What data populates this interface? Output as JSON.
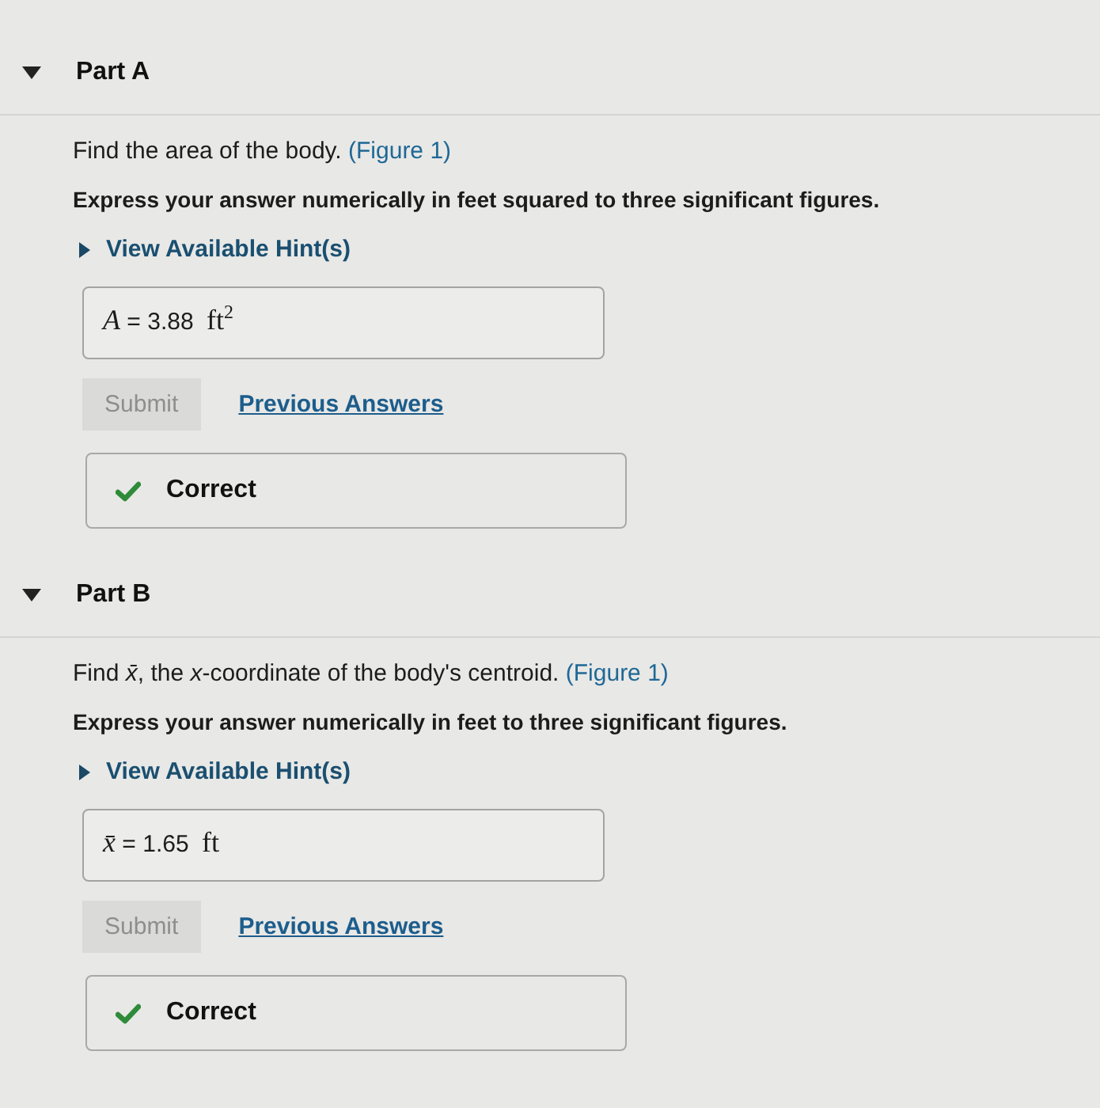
{
  "parts": [
    {
      "title": "Part A",
      "expanded": true,
      "prompt": "Find the area of the body.",
      "figure_link": "(Figure 1)",
      "instruction": "Express your answer numerically in feet squared to three significant figures.",
      "hint": {
        "label": "View Available Hint(s)",
        "expanded": false
      },
      "answer": {
        "variable": "A",
        "relation": "=",
        "value": "3.88",
        "unit": "ft$^{2}$"
      },
      "submit": {
        "label": "Submit",
        "disabled": true
      },
      "previous_link": "Previous Answers",
      "feedback": {
        "kind": "correct",
        "label": "Correct"
      }
    },
    {
      "title": "Part B",
      "expanded": true,
      "prompt": "Find *x̄*, the *x*-coordinate of the body's centroid.",
      "figure_link": "(Figure 1)",
      "instruction": "Express your answer numerically in feet to three significant figures.",
      "hint": {
        "label": "View Available Hint(s)",
        "expanded": false
      },
      "answer": {
        "variable": "x̄",
        "relation": "=",
        "value": "1.65",
        "unit": "ft"
      },
      "submit": {
        "label": "Submit",
        "disabled": true
      },
      "previous_link": "Previous Answers",
      "feedback": {
        "kind": "correct",
        "label": "Correct"
      }
    }
  ]
}
